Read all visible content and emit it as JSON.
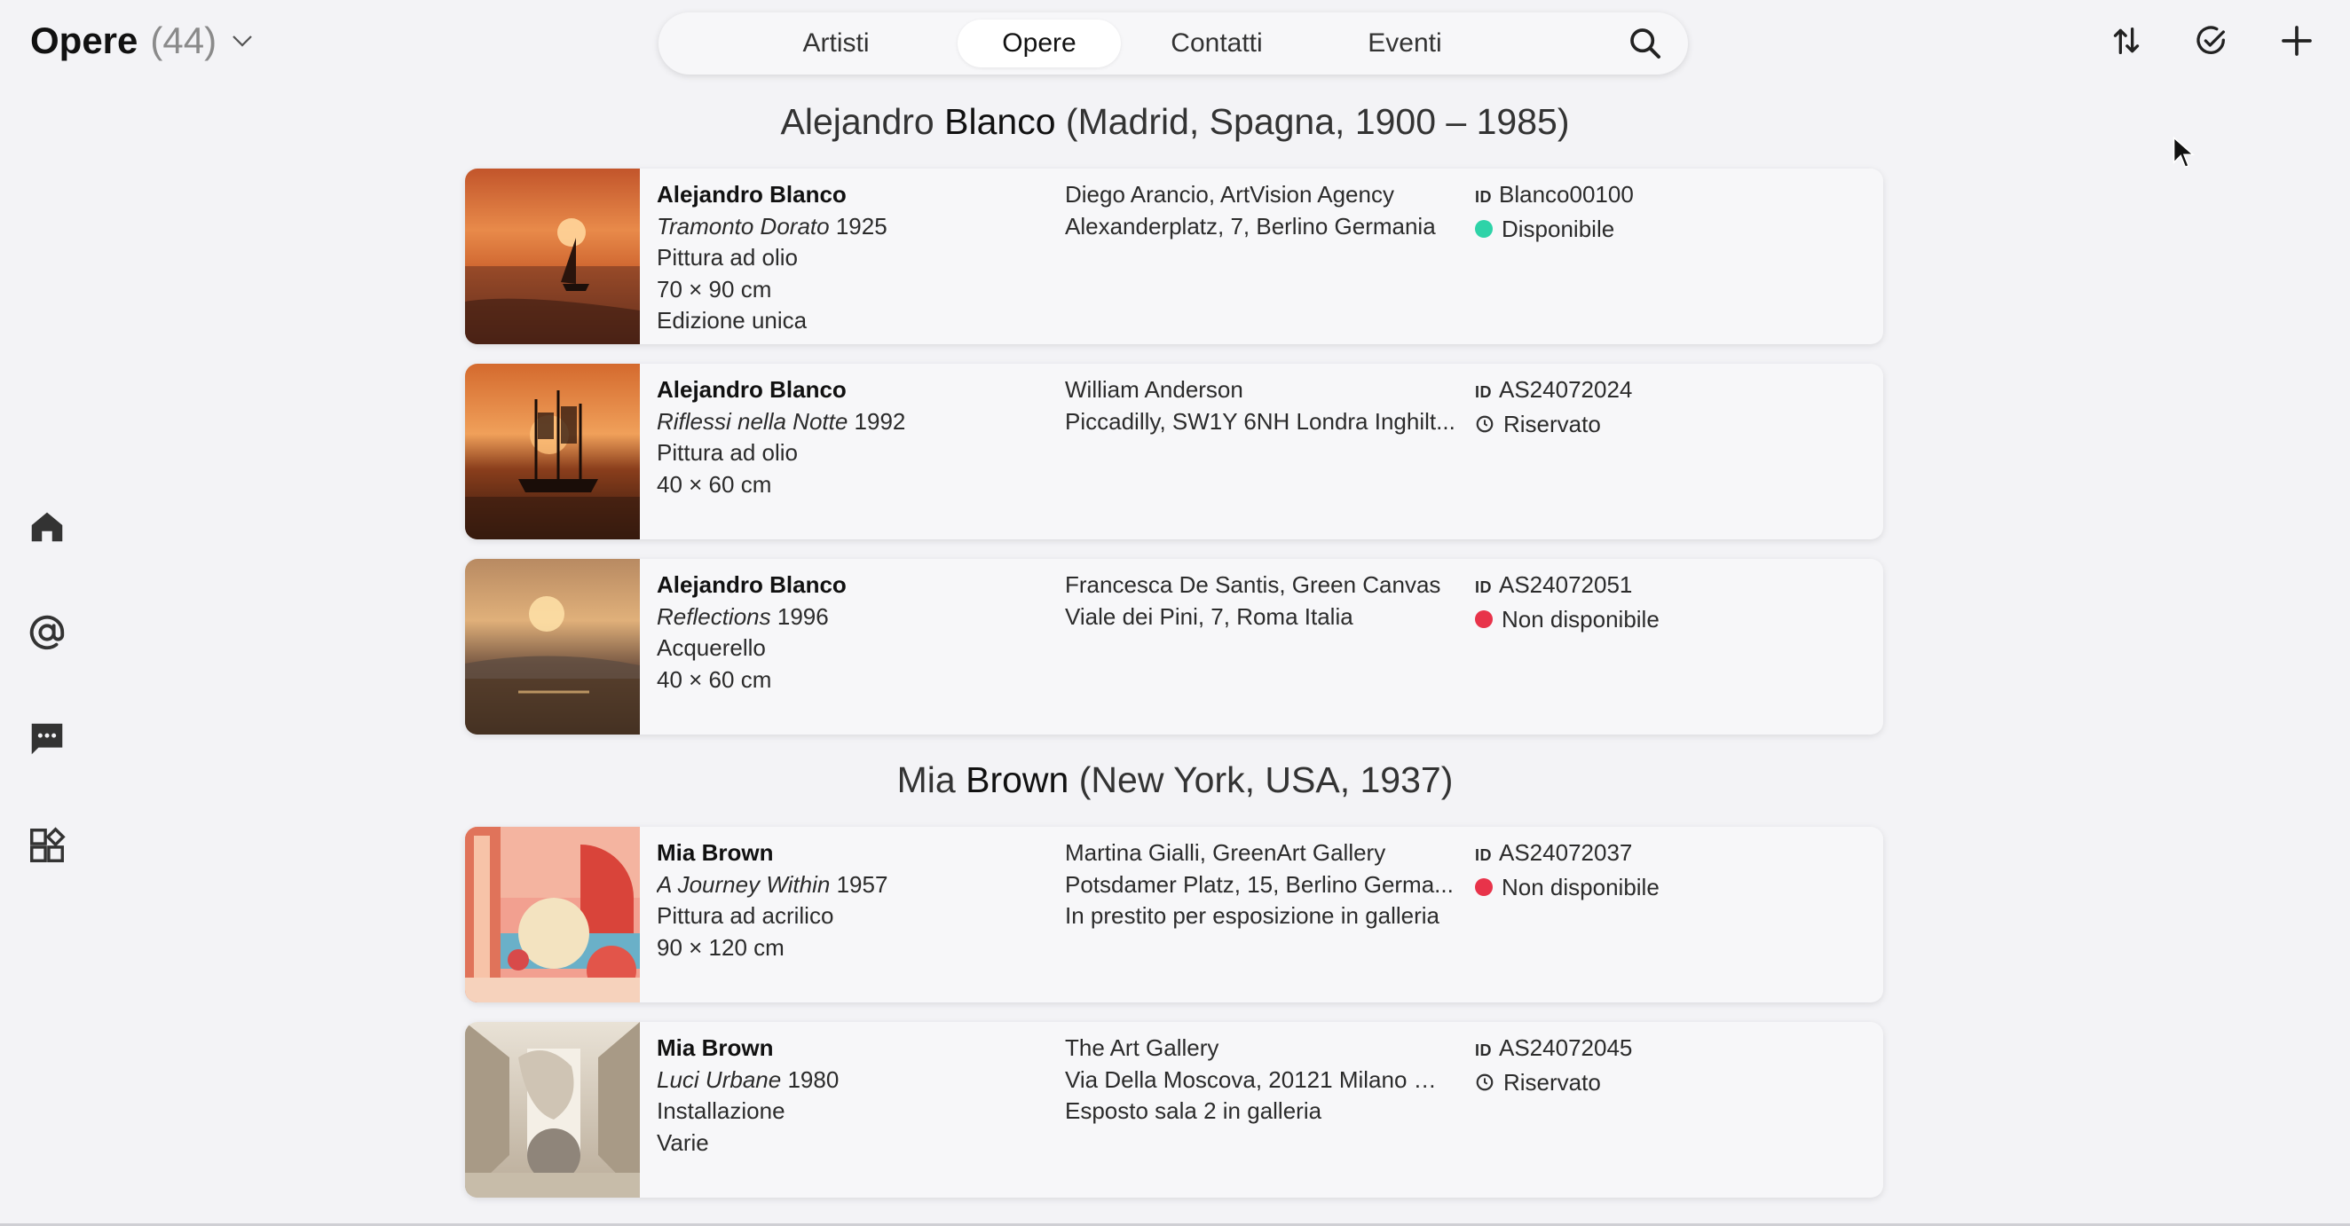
{
  "header": {
    "title": "Opere",
    "count": "(44)",
    "tabs": [
      {
        "label": "Artisti",
        "active": false
      },
      {
        "label": "Opere",
        "active": true
      },
      {
        "label": "Contatti",
        "active": false
      },
      {
        "label": "Eventi",
        "active": false
      }
    ],
    "icons": [
      "sort-icon",
      "check-circle-icon",
      "plus-icon",
      "search-icon",
      "chevron-down-icon"
    ]
  },
  "sidebar": {
    "icons": [
      "home-icon",
      "at-icon",
      "chat-icon",
      "apps-icon"
    ]
  },
  "groups": [
    {
      "first": "Alejandro",
      "surname": "Blanco",
      "details": "(Madrid, Spagna, 1900 – 1985)",
      "items": [
        {
          "artist": "Alejandro Blanco",
          "title": "Tramonto Dorato",
          "year": "1925",
          "medium": "Pittura ad olio",
          "size": "70 × 90 cm",
          "edition": "Edizione unica",
          "owner": "Diego Arancio, ArtVision Agency",
          "address": "Alexanderplatz, 7, Berlino Germania",
          "note": "",
          "id_label": "ID",
          "id": "Blanco00100",
          "status": "Disponibile",
          "status_color": "#2ed3a8",
          "status_kind": "dot"
        },
        {
          "artist": "Alejandro Blanco",
          "title": "Riflessi nella Notte",
          "year": "1992",
          "medium": "Pittura ad olio",
          "size": "40 × 60 cm",
          "edition": "",
          "owner": "William Anderson",
          "address": "Piccadilly, SW1Y 6NH Londra Inghilt...",
          "note": "",
          "id_label": "ID",
          "id": "AS24072024",
          "status": "Riservato",
          "status_color": "#333333",
          "status_kind": "clock"
        },
        {
          "artist": "Alejandro Blanco",
          "title": "Reflections",
          "year": "1996",
          "medium": "Acquerello",
          "size": "40 × 60 cm",
          "edition": "",
          "owner": "Francesca De Santis, Green Canvas",
          "address": "Viale dei Pini, 7, Roma Italia",
          "note": "",
          "id_label": "ID",
          "id": "AS24072051",
          "status": "Non disponibile",
          "status_color": "#e8334a",
          "status_kind": "dot"
        }
      ]
    },
    {
      "first": "Mia",
      "surname": "Brown",
      "details": "(New York, USA, 1937)",
      "items": [
        {
          "artist": "Mia Brown",
          "title": "A Journey Within",
          "year": "1957",
          "medium": "Pittura ad acrilico",
          "size": "90 × 120 cm",
          "edition": "",
          "owner": "Martina Gialli, GreenArt Gallery",
          "address": "Potsdamer Platz, 15, Berlino Germa...",
          "note": "In prestito per esposizione in galleria",
          "id_label": "ID",
          "id": "AS24072037",
          "status": "Non disponibile",
          "status_color": "#e8334a",
          "status_kind": "dot"
        },
        {
          "artist": "Mia Brown",
          "title": "Luci Urbane",
          "year": "1980",
          "medium": "Installazione",
          "size": "Varie",
          "edition": "",
          "owner": "The Art Gallery",
          "address": "Via Della Moscova, 20121 Milano MI...",
          "note": "Esposto sala 2 in galleria",
          "id_label": "ID",
          "id": "AS24072045",
          "status": "Riservato",
          "status_color": "#333333",
          "status_kind": "clock"
        }
      ]
    }
  ]
}
